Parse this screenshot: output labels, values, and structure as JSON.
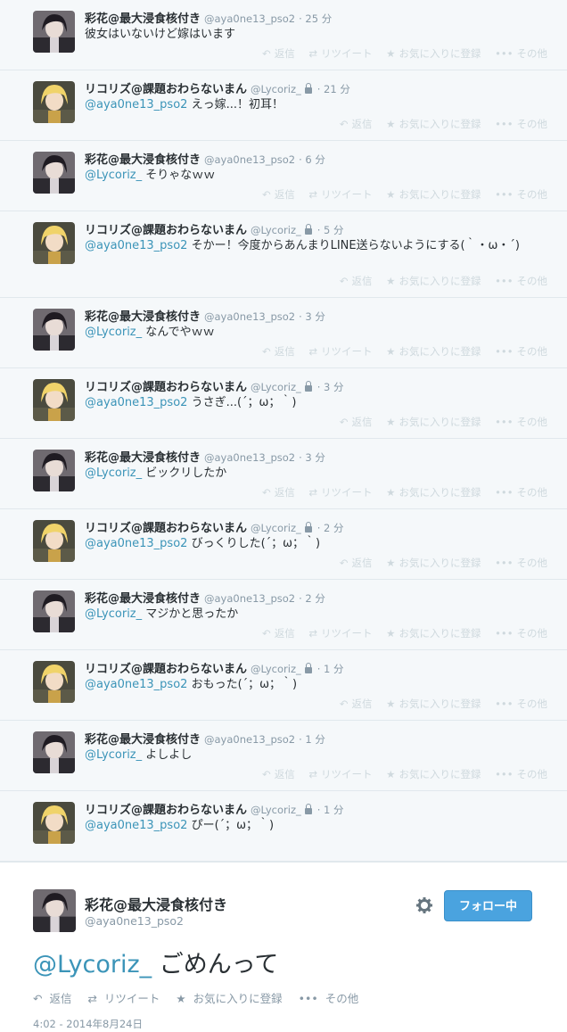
{
  "users": {
    "aya": {
      "name": "彩花@最大浸食核付き",
      "handle": "@aya0ne13_pso2"
    },
    "lyc": {
      "name": "リコリズ@課題おわらないまん",
      "handle": "@Lycoriz_"
    }
  },
  "actions": {
    "reply": "返信",
    "retweet": "リツイート",
    "favorite": "お気に入りに登録",
    "more": "その他"
  },
  "tweets": [
    {
      "name": "彩花@最大浸食核付き",
      "handle": "@aya0ne13_pso2",
      "time": "· 25 分",
      "mention": "",
      "text": "彼女はいないけど嫁はいます"
    },
    {
      "name": "リコリズ@課題おわらないまん",
      "handle": "@Lycoriz_",
      "time": "· 21 分",
      "mention": "@aya0ne13_pso2",
      "text": " えっ嫁...！初耳！"
    },
    {
      "name": "彩花@最大浸食核付き",
      "handle": "@aya0ne13_pso2",
      "time": "· 6 分",
      "mention": "@Lycoriz_",
      "text": " そりゃなｗｗ"
    },
    {
      "name": "リコリズ@課題おわらないまん",
      "handle": "@Lycoriz_",
      "time": "· 5 分",
      "mention": "@aya0ne13_pso2",
      "text": " そかー！今度からあんまりLINE送らないようにする(｀・ω・´)"
    },
    {
      "name": "彩花@最大浸食核付き",
      "handle": "@aya0ne13_pso2",
      "time": "· 3 分",
      "mention": "@Lycoriz_",
      "text": " なんでやｗｗ"
    },
    {
      "name": "リコリズ@課題おわらないまん",
      "handle": "@Lycoriz_",
      "time": "· 3 分",
      "mention": "@aya0ne13_pso2",
      "text": " うさぎ...(´；ω；｀)"
    },
    {
      "name": "彩花@最大浸食核付き",
      "handle": "@aya0ne13_pso2",
      "time": "· 3 分",
      "mention": "@Lycoriz_",
      "text": " ビックリしたか"
    },
    {
      "name": "リコリズ@課題おわらないまん",
      "handle": "@Lycoriz_",
      "time": "· 2 分",
      "mention": "@aya0ne13_pso2",
      "text": " びっくりした(´；ω；｀)"
    },
    {
      "name": "彩花@最大浸食核付き",
      "handle": "@aya0ne13_pso2",
      "time": "· 2 分",
      "mention": "@Lycoriz_",
      "text": " マジかと思ったか"
    },
    {
      "name": "リコリズ@課題おわらないまん",
      "handle": "@Lycoriz_",
      "time": "· 1 分",
      "mention": "@aya0ne13_pso2",
      "text": " おもった(´；ω；｀)"
    },
    {
      "name": "彩花@最大浸食核付き",
      "handle": "@aya0ne13_pso2",
      "time": "· 1 分",
      "mention": "@Lycoriz_",
      "text": " よしよし"
    },
    {
      "name": "リコリズ@課題おわらないまん",
      "handle": "@Lycoriz_",
      "time": "· 1 分",
      "mention": "@aya0ne13_pso2",
      "text": " ぴー(´；ω；｀)"
    }
  ],
  "focus": {
    "name": "彩花@最大浸食核付き",
    "handle": "@aya0ne13_pso2",
    "follow_label": "フォロー中",
    "mention": "@Lycoriz_",
    "text": " ごめんって",
    "timestamp": "4:02 - 2014年8月24日"
  },
  "colors": {
    "link": "#3b94b8",
    "button": "#4aa3df",
    "muted": "#8899a6"
  }
}
